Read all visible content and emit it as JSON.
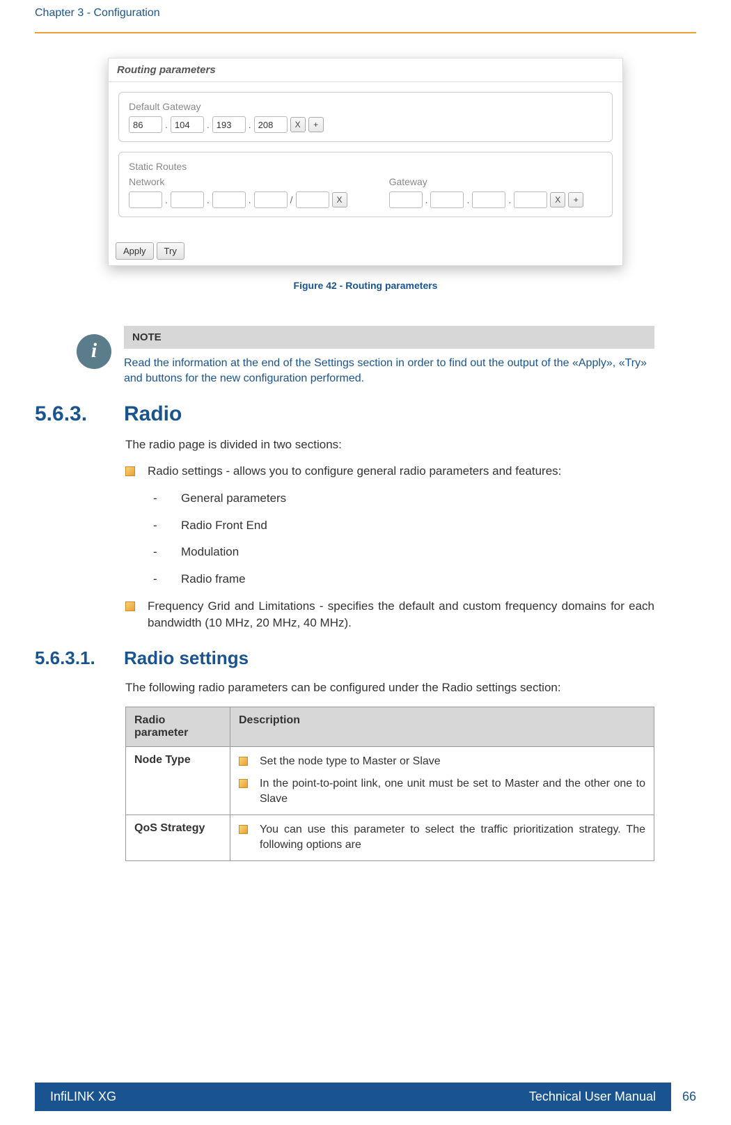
{
  "header": {
    "chapter": "Chapter 3 - Configuration"
  },
  "figure": {
    "panel_title": "Routing parameters",
    "gateway_label": "Default Gateway",
    "gw_ip": [
      "86",
      "104",
      "193",
      "208"
    ],
    "static_label": "Static Routes",
    "network_label": "Network",
    "gateway_col_label": "Gateway",
    "btn_x": "X",
    "btn_plus": "+",
    "btn_apply": "Apply",
    "btn_try": "Try",
    "slash": "/",
    "caption": "Figure 42 - Routing parameters"
  },
  "note": {
    "title": "NOTE",
    "text": "Read the information at the end of the Settings section in order to find out the output of the «Apply», «Try» and buttons for the new configuration performed."
  },
  "section1": {
    "num": "5.6.3.",
    "title": "Radio",
    "intro": "The radio page is divided in two sections:",
    "bullet1": "Radio settings - allows you to configure  general  radio parameters and features:",
    "sub1": "General parameters",
    "sub2": "Radio Front End",
    "sub3": "Modulation",
    "sub4": "Radio frame",
    "bullet2": "Frequency Grid and Limitations - specifies the  default and custom  frequency domains for each  bandwidth (10 MHz, 20 MHz, 40 MHz)."
  },
  "section2": {
    "num": "5.6.3.1.",
    "title": "Radio settings",
    "intro": "The following radio parameters can be configured under the Radio settings section:"
  },
  "table": {
    "h1": "Radio parameter",
    "h2": "Description",
    "r1c1": "Node Type",
    "r1b1": "Set the node type to Master or Slave",
    "r1b2": "In the point-to-point link, one unit must be set to Master and the other one to Slave",
    "r2c1": "QoS Strategy",
    "r2b1": "You can use this parameter to select the traffic prioritization strategy. The following options are"
  },
  "footer": {
    "left": "InfiLINK XG",
    "right": "Technical User Manual",
    "page": "66"
  },
  "icon": {
    "info": "i"
  },
  "dash": "-"
}
